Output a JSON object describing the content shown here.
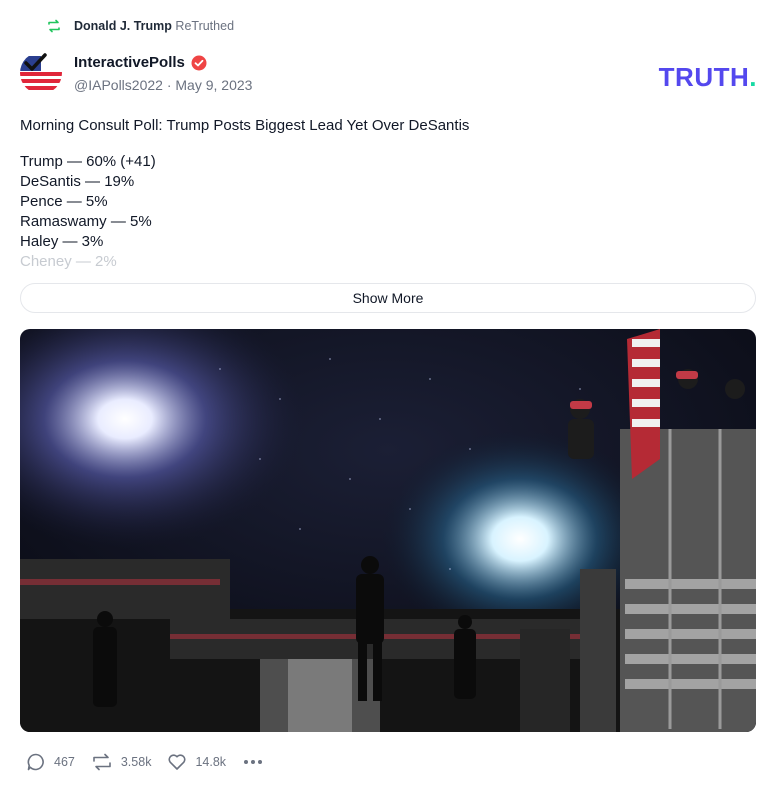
{
  "retruth": {
    "user": "Donald J. Trump",
    "action": "ReTruthed"
  },
  "author": {
    "display_name": "InteractivePolls",
    "handle": "@IAPolls2022",
    "date": "May 9, 2023",
    "verified": true
  },
  "logo": {
    "text": "TRUTH",
    "dot": "."
  },
  "post": {
    "headline": "Morning Consult Poll: Trump Posts Biggest Lead Yet Over DeSantis",
    "lines": [
      "Trump — 60% (+41)",
      "DeSantis — 19%",
      "Pence — 5%",
      "Ramaswamy — 5%",
      "Haley — 3%",
      "Cheney — 2%"
    ],
    "show_more_label": "Show More"
  },
  "stats": {
    "replies": "467",
    "retruths": "3.58k",
    "likes": "14.8k"
  },
  "colors": {
    "brand": "#5448ee",
    "brand_dot": "#17d9a3",
    "retruth_green": "#22c55e",
    "verified": "#ef4444"
  },
  "icons": [
    "retruth-icon",
    "verified-icon",
    "reply-icon",
    "like-icon",
    "more-icon"
  ]
}
